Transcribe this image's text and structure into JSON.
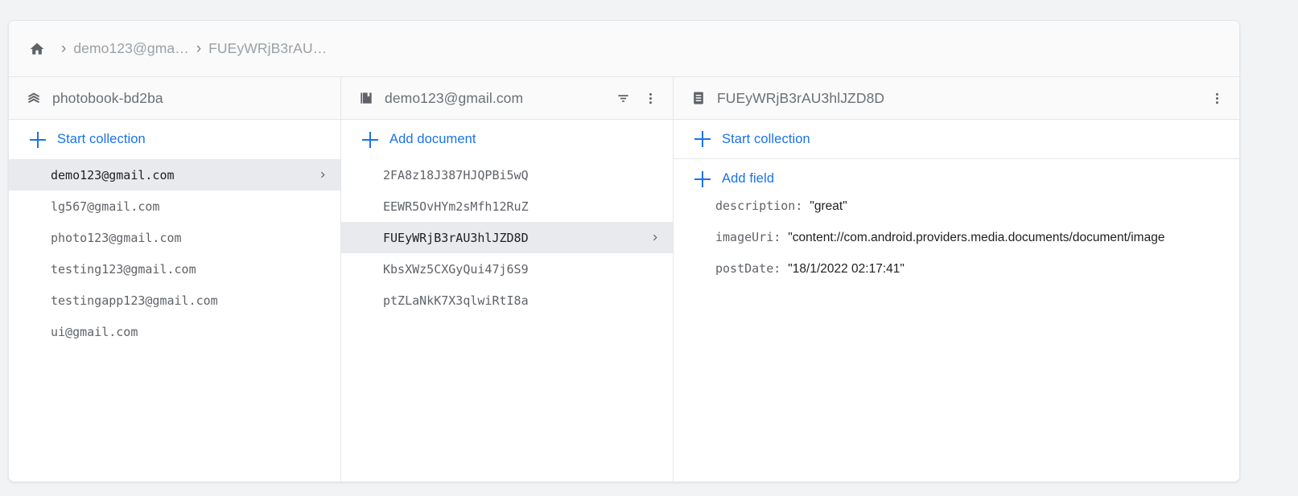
{
  "app": {
    "background_color": "#f1f3f4",
    "accent_color": "#1a73e8",
    "selected_row_color": "#e8eaed"
  },
  "breadcrumb": {
    "home_icon": "home-icon",
    "separator": "›",
    "items": [
      {
        "label": "demo123@gma…"
      },
      {
        "label": "FUEyWRjB3rAU…"
      }
    ]
  },
  "columns": {
    "database": {
      "header": {
        "icon": "database-stack-icon",
        "title": "photobook-bd2ba"
      },
      "action": {
        "icon": "plus-icon",
        "label": "Start collection"
      },
      "items": [
        {
          "label": "demo123@gmail.com",
          "selected": true
        },
        {
          "label": "lg567@gmail.com",
          "selected": false
        },
        {
          "label": "photo123@gmail.com",
          "selected": false
        },
        {
          "label": "testing123@gmail.com",
          "selected": false
        },
        {
          "label": "testingapp123@gmail.com",
          "selected": false
        },
        {
          "label": "ui@gmail.com",
          "selected": false
        }
      ]
    },
    "collection": {
      "header": {
        "icon": "collection-icon",
        "title": "demo123@gmail.com",
        "filter_icon": "filter-icon",
        "menu_icon": "more-vert-icon"
      },
      "action": {
        "icon": "plus-icon",
        "label": "Add document"
      },
      "items": [
        {
          "label": "2FA8z18J387HJQPBi5wQ",
          "selected": false
        },
        {
          "label": "EEWR5OvHYm2sMfh12RuZ",
          "selected": false
        },
        {
          "label": "FUEyWRjB3rAU3hlJZD8D",
          "selected": true
        },
        {
          "label": "KbsXWz5CXGyQui47j6S9",
          "selected": false
        },
        {
          "label": "ptZLaNkK7X3qlwiRtI8a",
          "selected": false
        }
      ]
    },
    "document": {
      "header": {
        "icon": "document-icon",
        "title": "FUEyWRjB3rAU3hlJZD8D",
        "menu_icon": "more-vert-icon"
      },
      "start_collection": {
        "icon": "plus-icon",
        "label": "Start collection"
      },
      "add_field": {
        "icon": "plus-icon",
        "label": "Add field"
      },
      "fields": [
        {
          "key": "description",
          "colon": ":",
          "value": "\"great\""
        },
        {
          "key": "imageUri",
          "colon": ":",
          "value": "\"content://com.android.providers.media.documents/document/image"
        },
        {
          "key": "postDate",
          "colon": ":",
          "value": "\"18/1/2022 02:17:41\""
        }
      ]
    }
  }
}
